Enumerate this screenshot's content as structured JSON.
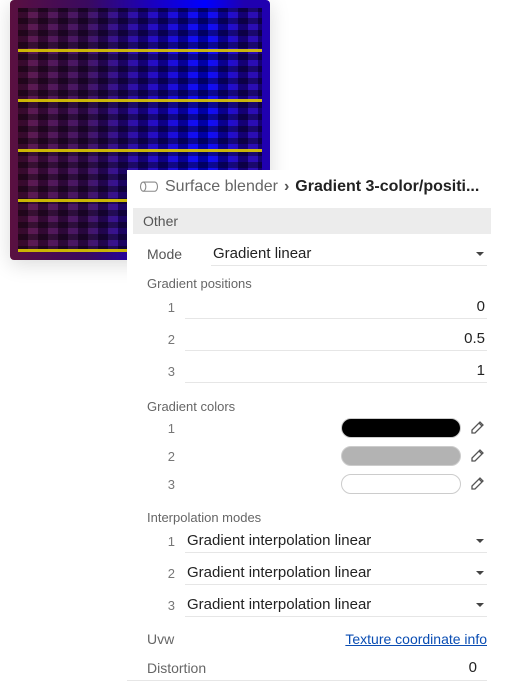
{
  "breadcrumb": {
    "parent": "Surface blender",
    "current": "Gradient 3-color/positi..."
  },
  "section_header": "Other",
  "mode": {
    "label": "Mode",
    "value": "Gradient linear"
  },
  "gradient_positions": {
    "label": "Gradient positions",
    "items": [
      {
        "idx": "1",
        "value": "0"
      },
      {
        "idx": "2",
        "value": "0.5"
      },
      {
        "idx": "3",
        "value": "1"
      }
    ]
  },
  "gradient_colors": {
    "label": "Gradient colors",
    "items": [
      {
        "idx": "1",
        "hex": "#000000"
      },
      {
        "idx": "2",
        "hex": "#b3b3b3"
      },
      {
        "idx": "3",
        "hex": "#ffffff"
      }
    ]
  },
  "interpolation": {
    "label": "Interpolation modes",
    "items": [
      {
        "idx": "1",
        "value": "Gradient interpolation linear"
      },
      {
        "idx": "2",
        "value": "Gradient interpolation linear"
      },
      {
        "idx": "3",
        "value": "Gradient interpolation linear"
      }
    ]
  },
  "uvw": {
    "label": "Uvw",
    "link": "Texture coordinate info"
  },
  "distortion": {
    "label": "Distortion",
    "value": "0"
  }
}
